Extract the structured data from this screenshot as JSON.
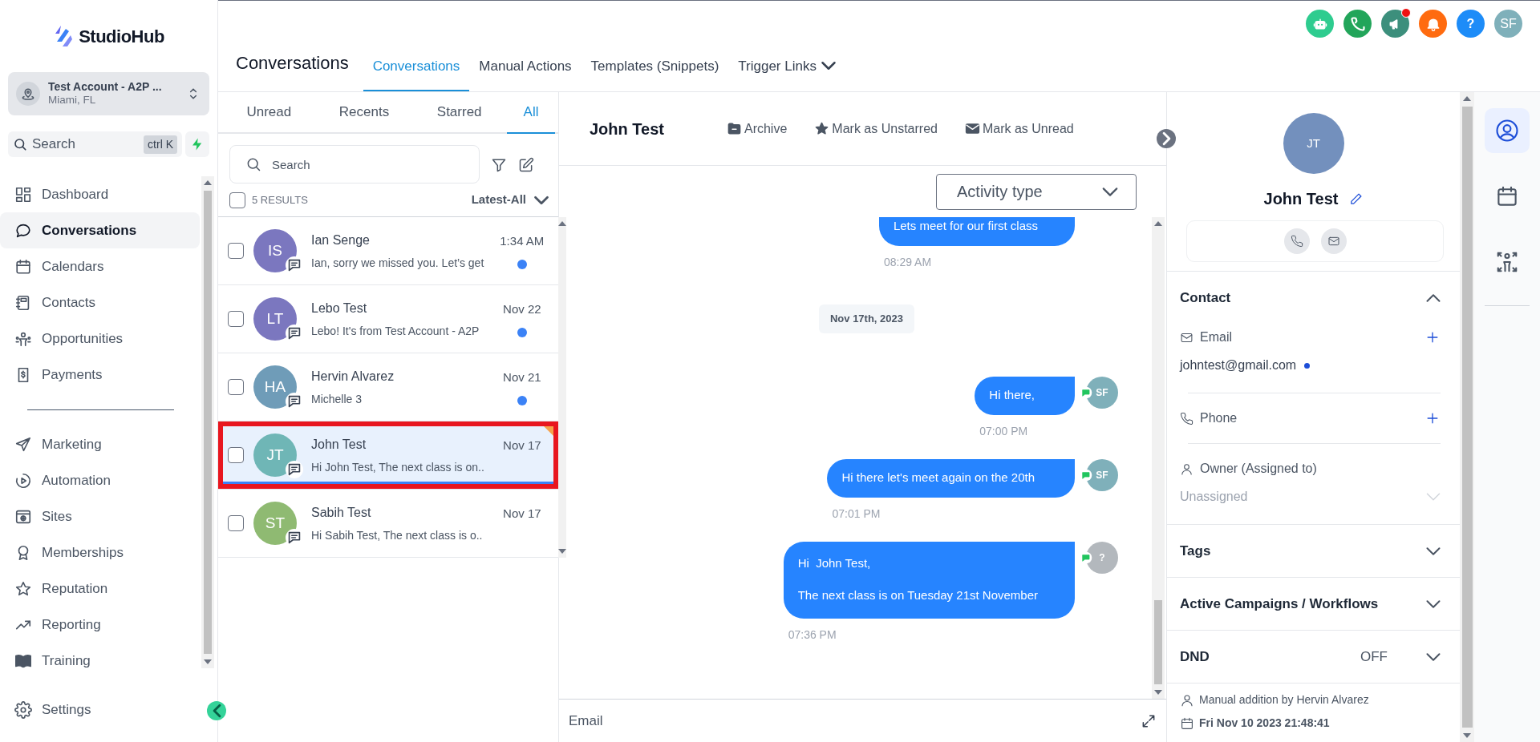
{
  "sidebar": {
    "brand": "StudioHub",
    "account": {
      "name": "Test Account - A2P ...",
      "location": "Miami, FL"
    },
    "search": {
      "placeholder": "Search",
      "shortcut": "ctrl K"
    },
    "nav_groups": [
      [
        {
          "label": "Dashboard",
          "selected": false
        },
        {
          "label": "Conversations",
          "selected": true
        },
        {
          "label": "Calendars",
          "selected": false
        },
        {
          "label": "Contacts",
          "selected": false
        },
        {
          "label": "Opportunities",
          "selected": false
        },
        {
          "label": "Payments",
          "selected": false
        }
      ],
      [
        {
          "label": "Marketing",
          "selected": false
        },
        {
          "label": "Automation",
          "selected": false
        },
        {
          "label": "Sites",
          "selected": false
        },
        {
          "label": "Memberships",
          "selected": false
        },
        {
          "label": "Reputation",
          "selected": false
        },
        {
          "label": "Reporting",
          "selected": false
        },
        {
          "label": "Training",
          "selected": false
        }
      ]
    ],
    "settings": {
      "label": "Settings"
    }
  },
  "header": {
    "actions": [
      {
        "kind": "icon",
        "color": "#2ecc8f",
        "badge": false
      },
      {
        "kind": "icon",
        "color": "#22a55a",
        "badge": false
      },
      {
        "kind": "icon",
        "color": "#3c8f7c",
        "badge": true
      },
      {
        "kind": "icon",
        "color": "#ff6b0f",
        "badge": false
      },
      {
        "kind": "text",
        "label": "?",
        "color": "#1d8cf8",
        "badge": false
      },
      {
        "kind": "text",
        "label": "SF",
        "color": "#7fb0ba",
        "badge": false
      }
    ],
    "title": "Conversations",
    "tabs": [
      {
        "label": "Conversations",
        "selected": true,
        "dropdown": false
      },
      {
        "label": "Manual Actions",
        "selected": false,
        "dropdown": false
      },
      {
        "label": "Templates (Snippets)",
        "selected": false,
        "dropdown": false
      },
      {
        "label": "Trigger Links",
        "selected": false,
        "dropdown": true
      }
    ]
  },
  "conversation_list": {
    "tabs": [
      {
        "label": "Unread",
        "selected": false
      },
      {
        "label": "Recents",
        "selected": false
      },
      {
        "label": "Starred",
        "selected": false
      },
      {
        "label": "All",
        "selected": true
      }
    ],
    "search": {
      "placeholder": "Search"
    },
    "all_selected": false,
    "results": "5 RESULTS",
    "sort": "Latest-All",
    "rows": [
      {
        "initials": "IS",
        "color": "#7b77bf",
        "name": "Ian Senge",
        "preview": "Ian, sorry we missed you. Let’s get",
        "time": "1:34 AM",
        "unread": true,
        "starred": false,
        "selected": false,
        "highlighted": false,
        "checked": false
      },
      {
        "initials": "LT",
        "color": "#7b77bf",
        "name": "Lebo Test",
        "preview": "Lebo! It's from Test Account - A2P",
        "time": "Nov 22",
        "unread": true,
        "starred": false,
        "selected": false,
        "highlighted": false,
        "checked": false
      },
      {
        "initials": "HA",
        "color": "#6f9cb8",
        "name": "Hervin Alvarez",
        "preview": "Michelle 3",
        "time": "Nov 21",
        "unread": true,
        "starred": false,
        "selected": false,
        "highlighted": false,
        "checked": false
      },
      {
        "initials": "JT",
        "color": "#6fb6b6",
        "name": "John Test",
        "preview": "Hi John Test, The next class is on..",
        "time": "Nov 17",
        "unread": false,
        "starred": true,
        "selected": true,
        "highlighted": true,
        "checked": false
      },
      {
        "initials": "ST",
        "color": "#8fba72",
        "name": "Sabih Test",
        "preview": "Hi Sabih Test, The next class is o..",
        "time": "Nov 17",
        "unread": false,
        "starred": false,
        "selected": false,
        "highlighted": false,
        "checked": false
      }
    ]
  },
  "chat": {
    "contact_name": "John Test",
    "actions": [
      {
        "label": "Archive"
      },
      {
        "label": "Mark as Unstarred"
      },
      {
        "label": "Mark as Unread"
      }
    ],
    "activity_filter": {
      "placeholder": "Activity type"
    },
    "messages": [
      {
        "kind": "message",
        "lines": [
          "Lets meet for our first class"
        ],
        "time": "08:29 AM"
      },
      {
        "kind": "date",
        "label": "Nov 17th, 2023"
      },
      {
        "kind": "message",
        "lines": [
          "Hi there,"
        ],
        "time": "07:00 PM",
        "avatar": {
          "initials": "SF",
          "color": "#7fb0ba"
        }
      },
      {
        "kind": "message",
        "lines": [
          "Hi there let's meet again on the 20th"
        ],
        "time": "07:01 PM",
        "avatar": {
          "initials": "SF",
          "color": "#7fb0ba"
        }
      },
      {
        "kind": "message",
        "lines": [
          "Hi  John Test,",
          "The next class is on Tuesday 21st November"
        ],
        "time": "07:36 PM",
        "avatar": {
          "initials": "?",
          "color": "#b3b8bd"
        }
      }
    ],
    "composer": {
      "channel": "Email"
    }
  },
  "contact_panel": {
    "avatar": {
      "initials": "JT",
      "color": "#7390bd"
    },
    "name": "John Test",
    "sections": [
      {
        "kind": "contact",
        "title": "Contact",
        "expanded": true,
        "fields": [
          {
            "kind": "email",
            "label": "Email",
            "value": "johntest@gmail.com",
            "verified": true
          },
          {
            "kind": "phone",
            "label": "Phone"
          },
          {
            "kind": "owner",
            "label": "Owner (Assigned to)",
            "placeholder": "Unassigned"
          }
        ]
      },
      {
        "kind": "plain",
        "title": "Tags",
        "expanded": false
      },
      {
        "kind": "plain",
        "title": "Active Campaigns / Workflows",
        "expanded": false
      },
      {
        "kind": "plain",
        "title": "DND",
        "value": "OFF",
        "expanded": false
      }
    ],
    "footer": {
      "source": "Manual addition by Hervin Alvarez",
      "date": "Fri Nov 10 2023 21:48:41"
    }
  },
  "rail": [
    {
      "selected": true
    },
    {
      "selected": false
    },
    {
      "selected": false
    }
  ]
}
